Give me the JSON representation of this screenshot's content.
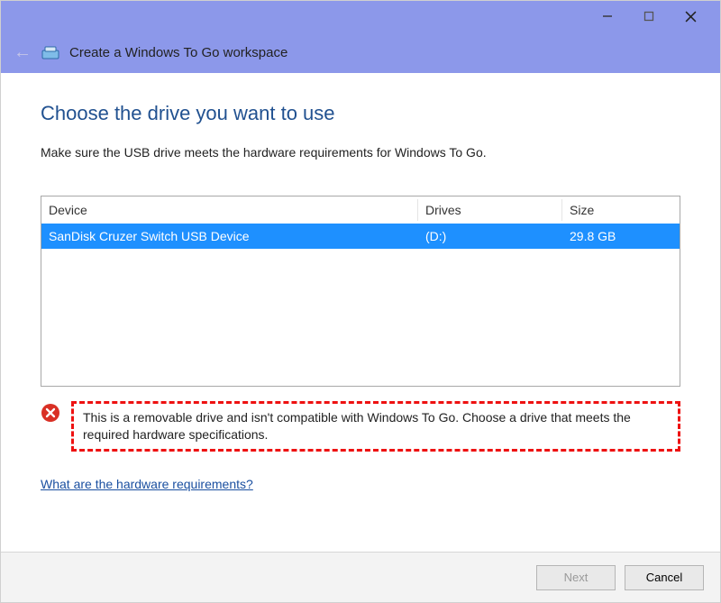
{
  "window": {
    "title": "Create a Windows To Go workspace"
  },
  "page": {
    "heading": "Choose the drive you want to use",
    "instruction": "Make sure the USB drive meets the hardware requirements for Windows To Go."
  },
  "table": {
    "columns": {
      "device": "Device",
      "drives": "Drives",
      "size": "Size"
    },
    "rows": [
      {
        "device": "SanDisk Cruzer Switch USB Device",
        "drives": "(D:)",
        "size": "29.8 GB"
      }
    ]
  },
  "error": {
    "message": "This is a removable drive and isn't compatible with Windows To Go. Choose a drive that meets the required hardware specifications."
  },
  "link": {
    "hardware_requirements": "What are the hardware requirements?"
  },
  "buttons": {
    "next": "Next",
    "cancel": "Cancel"
  }
}
